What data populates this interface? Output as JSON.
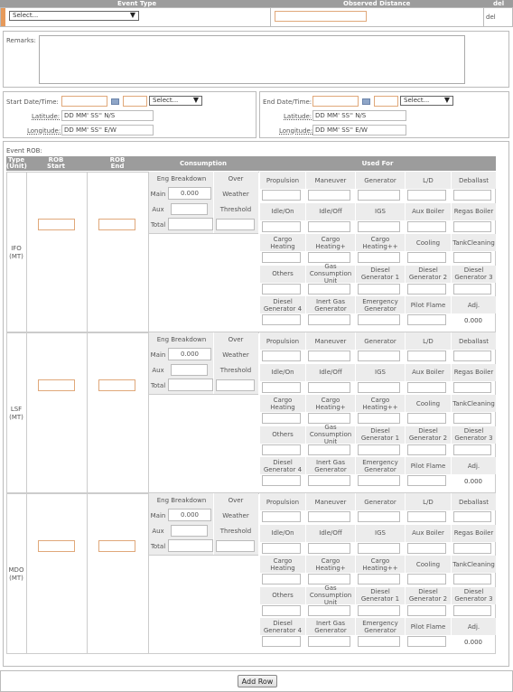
{
  "header": {
    "event_type": "Event Type",
    "observed_distance": "Observed Distance",
    "del": "del"
  },
  "row1": {
    "event_type_value": "Select...",
    "del_link": "del"
  },
  "remarks": {
    "label": "Remarks:"
  },
  "start": {
    "label": "Start Date/Time:",
    "select": "Select...",
    "lat_label": "Latitude:",
    "lat_value": "DD MM' SS'' N/S",
    "lon_label": "Longitude:",
    "lon_value": "DD MM' SS'' E/W"
  },
  "end": {
    "label": "End Date/Time:",
    "select": "Select...",
    "lat_label": "Latitude:",
    "lat_value": "DD MM' SS'' N/S",
    "lon_label": "Longitude:",
    "lon_value": "DD MM' SS'' E/W"
  },
  "rob": {
    "title": "Event ROB:",
    "headers": {
      "type": "Type",
      "type_unit": "(Unit)",
      "rob_start": "ROB",
      "rob_start2": "Start",
      "rob_end": "ROB",
      "rob_end2": "End",
      "consumption": "Consumption",
      "used_for": "Used For"
    },
    "fuels": [
      {
        "name": "IFO",
        "unit": "(MT)"
      },
      {
        "name": "LSF",
        "unit": "(MT)"
      },
      {
        "name": "MDO",
        "unit": "(MT)"
      }
    ],
    "eng": {
      "breakdown": "Eng Breakdown",
      "over": "Over",
      "weather": "Weather",
      "threshold": "Threshold",
      "main": "Main",
      "aux": "Aux",
      "total": "Total",
      "main_value": "0.000"
    },
    "used_for_rows": [
      [
        "Propulsion",
        "Maneuver",
        "Generator",
        "L/D",
        "Deballast"
      ],
      [
        "Idle/On",
        "Idle/Off",
        "IGS",
        "Aux Boiler",
        "Regas Boiler"
      ],
      [
        "Cargo Heating",
        "Cargo Heating+",
        "Cargo Heating++",
        "Cooling",
        "TankCleaning"
      ],
      [
        "Others",
        "Gas Consumption Unit",
        "Diesel Generator 1",
        "Diesel Generator 2",
        "Diesel Generator 3"
      ],
      [
        "Diesel Generator 4",
        "Inert Gas Generator",
        "Emergency Generator",
        "Pilot Flame",
        "Adj."
      ]
    ],
    "adj_value": "0.000"
  },
  "footer": {
    "add_row": "Add Row"
  }
}
